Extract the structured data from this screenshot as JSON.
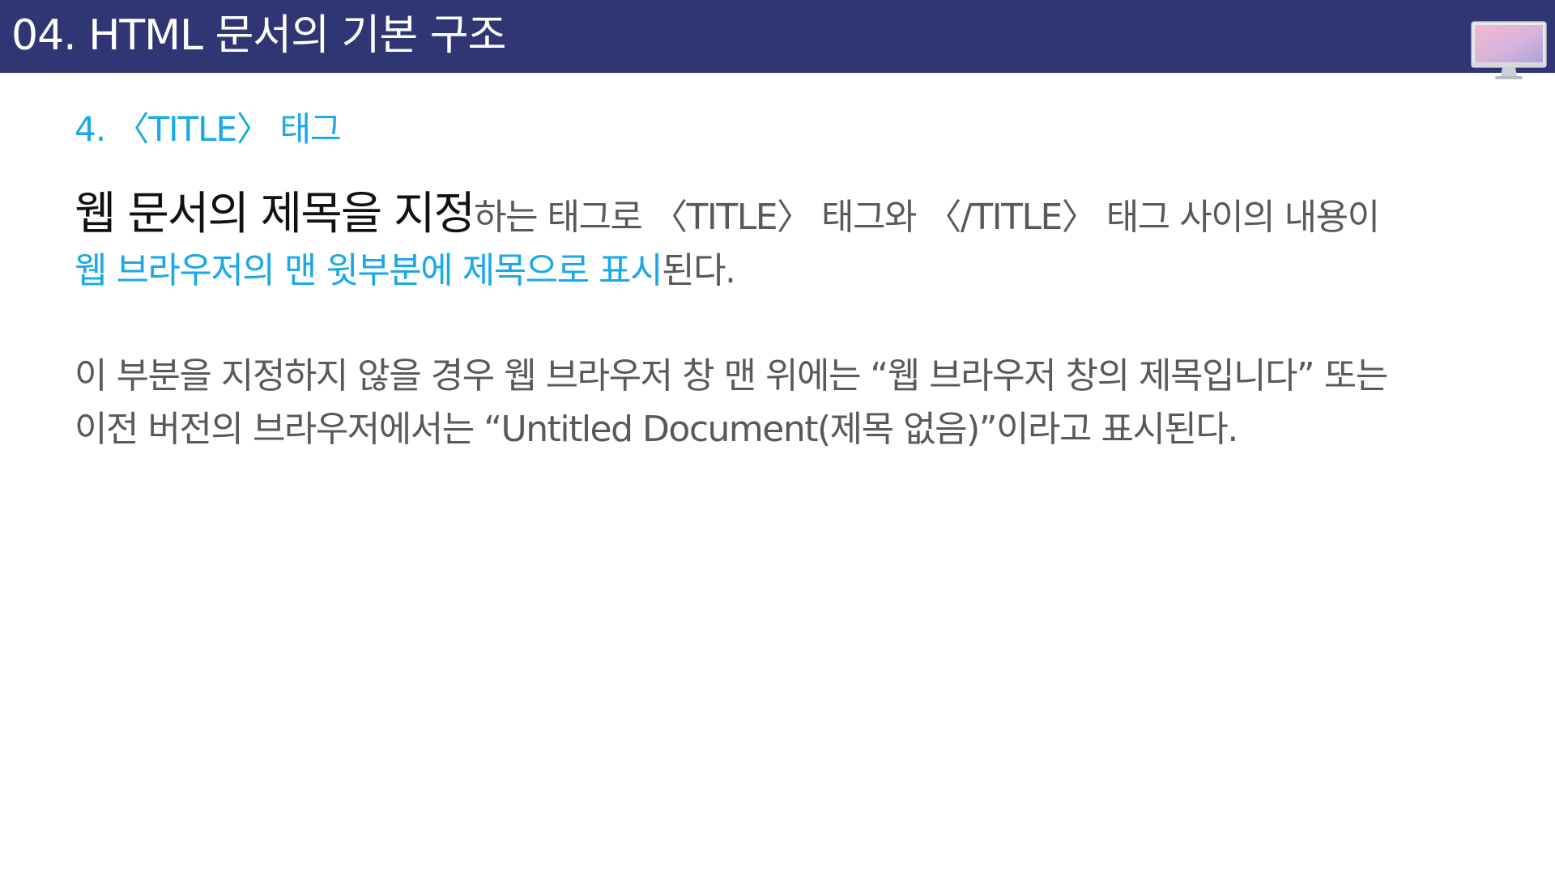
{
  "header": {
    "title": "04. HTML 문서의 기본 구조",
    "icon": "monitor-icon",
    "background": "#303673"
  },
  "section": {
    "heading": "4. 〈TITLE〉 태그",
    "accent_color": "#18a9e6"
  },
  "paragraph1": {
    "lead": "웹 문서의 제목을 지정",
    "rest_line1": "하는 태그로 〈TITLE〉 태그와 〈/TITLE〉 태그 사이의 내용이",
    "highlight_line2": "웹 브라우저의 맨 윗부분에 제목으로 표시",
    "rest_line2": "된다."
  },
  "paragraph2": {
    "line1": "이 부분을 지정하지 않을 경우 웹 브라우저 창 맨 위에는 “웹 브라우저 창의 제목입니다” 또는",
    "line2": "이전 버전의 브라우저에서는 “Untitled Document(제목 없음)”이라고 표시된다."
  }
}
